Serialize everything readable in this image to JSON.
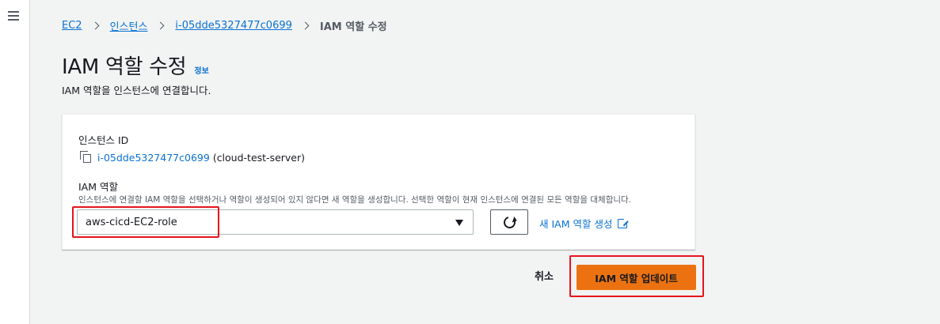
{
  "breadcrumb": {
    "items": [
      "EC2",
      "인스턴스",
      "i-05dde5327477c0699"
    ],
    "current": "IAM 역할 수정"
  },
  "header": {
    "title": "IAM 역할 수정",
    "info_link": "정보",
    "description": "IAM 역할을 인스턴스에 연결합니다."
  },
  "form": {
    "instance_label": "인스턴스 ID",
    "instance_id": "i-05dde5327477c0699",
    "instance_name": "(cloud-test-server)",
    "iam_label": "IAM 역할",
    "iam_help": "인스턴스에 연결할 IAM 역할을 선택하거나 역할이 생성되어 있지 않다면 새 역할을 생성합니다. 선택한 역할이 현재 인스턴스에 연결된 모든 역할을 대체합니다.",
    "selected_role": "aws-cicd-EC2-role",
    "create_role_link": "새 IAM 역할 생성"
  },
  "actions": {
    "cancel_label": "취소",
    "update_label": "IAM 역할 업데이트"
  },
  "colors": {
    "primary_button": "#ec7211",
    "link": "#0972d3",
    "highlight": "#e5141c"
  },
  "icons": [
    "menu-icon",
    "chevron-right-icon",
    "copy-icon",
    "caret-down-icon",
    "refresh-icon",
    "external-link-icon"
  ]
}
